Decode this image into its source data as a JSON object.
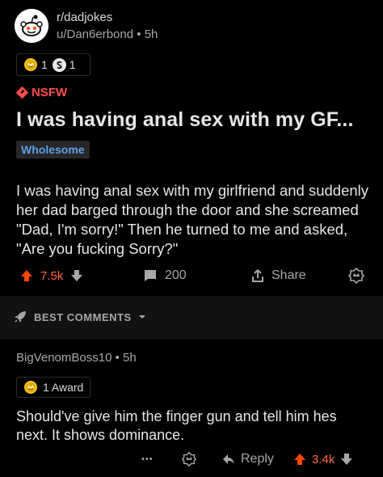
{
  "post": {
    "subreddit": "r/dadjokes",
    "author": "u/Dan6erbond",
    "separator": "•",
    "age": "5h",
    "awards": [
      {
        "icon": "gold-award-icon",
        "count": "1"
      },
      {
        "icon": "silver-award-icon",
        "count": "1"
      }
    ],
    "nsfw_label": "NSFW",
    "title": "I was having anal sex with my GF...",
    "flair": "Wholesome",
    "body": "I was having anal sex with my girlfriend and suddenly her dad barged through the door and she screamed \"Dad, I'm sorry!\" Then he turned to me and asked, \"Are you fucking Sorry?\"",
    "votes": "7.5k",
    "comments": "200",
    "share_label": "Share"
  },
  "sort": {
    "label": "BEST COMMENTS"
  },
  "comment": {
    "author": "BigVenomBoss10",
    "separator": "•",
    "age": "5h",
    "award_label": "1 Award",
    "body": "Should've give him the finger gun and tell him hes next. It shows dominance.",
    "more": "•••",
    "reply_label": "Reply",
    "votes": "3.4k"
  },
  "colors": {
    "upvote": "#ff4500",
    "nsfw": "#ff4d4d",
    "flair_text": "#5aa0e6",
    "background": "#000000",
    "band": "#121212"
  }
}
